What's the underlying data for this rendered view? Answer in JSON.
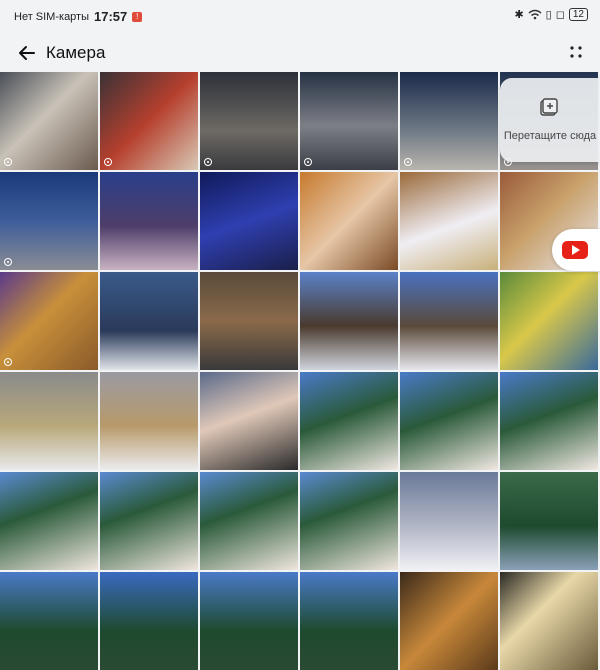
{
  "status_bar": {
    "carrier": "Нет SIM-карты",
    "time": "17:57",
    "battery": "12"
  },
  "header": {
    "title": "Камера"
  },
  "drop_zone": {
    "label": "Перетащите сюда"
  },
  "colors": {
    "background": "#f1f3f5",
    "youtube_red": "#e62117"
  },
  "photos": [
    {
      "name": "photo-ornament-closeup",
      "bg": "linear-gradient(135deg,#4a4f58,#c9c2b8 45%,#6b5a4e)",
      "live": true
    },
    {
      "name": "photo-red-wheel",
      "bg": "linear-gradient(135deg,#3a3236,#b6402e 50%,#d8c9b6)",
      "live": true
    },
    {
      "name": "photo-night-street-blur-1",
      "bg": "linear-gradient(180deg,#2c3038,#6e6a64 60%,#3a3a3e)",
      "live": true
    },
    {
      "name": "photo-night-street-car",
      "bg": "linear-gradient(180deg,#263244,#7d7f86 55%,#3c3f46)",
      "live": true
    },
    {
      "name": "photo-night-crossroad",
      "bg": "linear-gradient(180deg,#1c2a4a,#6f7a86 60%,#b9b4ae)",
      "live": true
    },
    {
      "name": "photo-night-street-2",
      "bg": "linear-gradient(180deg,#223350,#5d6876 60%,#9a9490)",
      "live": true
    },
    {
      "name": "photo-bus-evening",
      "bg": "linear-gradient(180deg,#1a3a7a,#3d5d9a 50%,#8a8c94)",
      "live": true
    },
    {
      "name": "photo-blue-trees-snow",
      "bg": "linear-gradient(180deg,#2a3f8a,#4d3e6a 55%,#c9b2c2)",
      "live": false
    },
    {
      "name": "photo-blue-lights-tree",
      "bg": "linear-gradient(160deg,#0f1a5a,#2f3fb0 50%,#1a1f4a)",
      "live": false
    },
    {
      "name": "photo-girl-snake-statue",
      "bg": "linear-gradient(135deg,#c67a2e,#e6c6a6 50%,#7a4a26)",
      "live": false
    },
    {
      "name": "photo-girl-posing-snow",
      "bg": "linear-gradient(160deg,#9a6a3a,#f0eef4 55%,#c8b07a)",
      "live": false
    },
    {
      "name": "photo-snake-statue-brick",
      "bg": "linear-gradient(135deg,#9a5a3a,#c8a06a 45%,#e8e6ea)",
      "live": false
    },
    {
      "name": "photo-snake-head",
      "bg": "linear-gradient(135deg,#5a3a8a,#c8903a 45%,#8a5a2a)",
      "live": true
    },
    {
      "name": "photo-ornate-house",
      "bg": "linear-gradient(180deg,#3a5a8a,#2a3a5a 60%,#e0e4ea)",
      "live": false
    },
    {
      "name": "photo-wooden-house-windows",
      "bg": "linear-gradient(180deg,#5a4a3a,#8a6a4a 50%,#3a3a3a)",
      "live": false
    },
    {
      "name": "photo-wooden-tower-house",
      "bg": "linear-gradient(180deg,#5a82c8,#4a3a2e 55%,#d0d4dc)",
      "live": false
    },
    {
      "name": "photo-house-snow",
      "bg": "linear-gradient(180deg,#4a72c0,#5a4a3a 55%,#e6e6ec)",
      "live": false
    },
    {
      "name": "photo-graffiti-snake",
      "bg": "linear-gradient(135deg,#5a8a3a,#d8c84a 45%,#3a6a9a)",
      "live": false
    },
    {
      "name": "photo-graffiti-wall-1",
      "bg": "linear-gradient(180deg,#8a8a8a,#b8a87a 55%,#e8e8ea)",
      "live": false
    },
    {
      "name": "photo-graffiti-wall-2",
      "bg": "linear-gradient(180deg,#9a9aa2,#b89a6a 55%,#ececee)",
      "live": false
    },
    {
      "name": "photo-selfie-couple",
      "bg": "linear-gradient(160deg,#5a6a8a,#e0c8b8 45%,#2a2a2a)",
      "live": false
    },
    {
      "name": "photo-girl-christmas-tree-1",
      "bg": "linear-gradient(160deg,#4a7ac8,#2a5a3a 45%,#f0e8e2)",
      "live": false
    },
    {
      "name": "photo-girl-christmas-tree-2",
      "bg": "linear-gradient(160deg,#4a7ac8,#2a5a3a 45%,#f0e8e2)",
      "live": false
    },
    {
      "name": "photo-girl-christmas-tree-3",
      "bg": "linear-gradient(160deg,#4a7ac8,#2a5a3a 45%,#f0e8e2)",
      "live": false
    },
    {
      "name": "photo-girl-tree-4",
      "bg": "linear-gradient(160deg,#5a8ad0,#2a5a3a 40%,#efe6de)",
      "live": false
    },
    {
      "name": "photo-girl-tree-5",
      "bg": "linear-gradient(160deg,#5a8ad0,#2a5a3a 40%,#efe6de)",
      "live": false
    },
    {
      "name": "photo-girl-tree-6",
      "bg": "linear-gradient(160deg,#5a8ad0,#2a5a3a 40%,#efe6de)",
      "live": false
    },
    {
      "name": "photo-girl-tree-7",
      "bg": "linear-gradient(160deg,#5a8ad0,#2a5a3a 40%,#efe6de)",
      "live": false
    },
    {
      "name": "photo-snow-figure",
      "bg": "linear-gradient(180deg,#6a7a9a,#aab0c0 50%,#f0f0f4)",
      "live": false
    },
    {
      "name": "photo-tree-mirror-ball",
      "bg": "linear-gradient(180deg,#3a6a4a,#1e4a2e 55%,#8aa0b8)",
      "live": false
    },
    {
      "name": "photo-tree-top-1",
      "bg": "linear-gradient(180deg,#4a7ac8,#1e4a2e 60%,#2a4a34)",
      "live": false
    },
    {
      "name": "photo-tree-star",
      "bg": "linear-gradient(180deg,#3a6ac0,#1e4a2e 60%,#2a4a34)",
      "live": false
    },
    {
      "name": "photo-tree-top-2",
      "bg": "linear-gradient(180deg,#4a7ac8,#1e4a2e 60%,#2a4a34)",
      "live": false
    },
    {
      "name": "photo-tree-top-3",
      "bg": "linear-gradient(180deg,#4a7ac8,#1e4a2e 60%,#2a4a34)",
      "live": false
    },
    {
      "name": "photo-golden-leaves",
      "bg": "linear-gradient(135deg,#3a2a1a,#c8883a 50%,#5a3a1a)",
      "live": false
    },
    {
      "name": "photo-dekor-sign",
      "bg": "linear-gradient(135deg,#2a2a24,#e8d8a8 40%,#6a5a3a)",
      "live": false
    }
  ]
}
